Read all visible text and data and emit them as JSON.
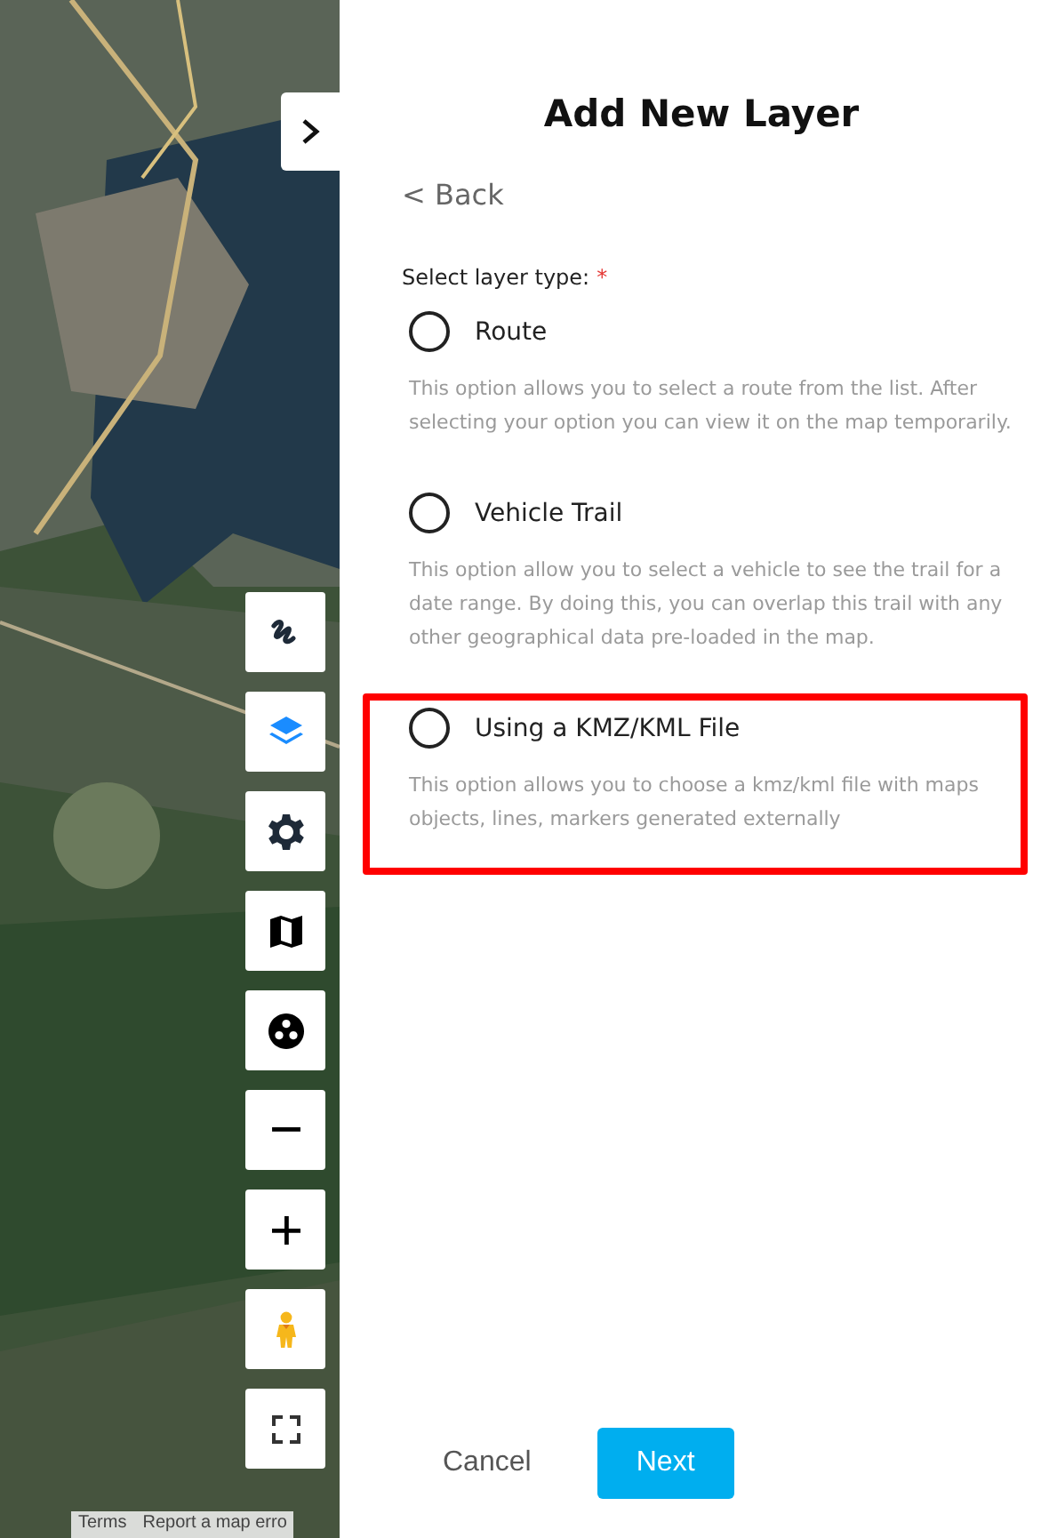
{
  "map": {
    "attribution": [
      "Terms",
      "Report a map erro"
    ],
    "controls": [
      {
        "kind": "trail"
      },
      {
        "kind": "layers"
      },
      {
        "kind": "settings"
      },
      {
        "kind": "map"
      },
      {
        "kind": "cluster"
      },
      {
        "kind": "zoom-out"
      },
      {
        "kind": "zoom-in"
      },
      {
        "kind": "pegman"
      },
      {
        "kind": "fullscreen"
      }
    ]
  },
  "panel": {
    "title": "Add New Layer",
    "back": "< Back",
    "field_label": "Select layer type:",
    "required_mark": "*",
    "options": [
      {
        "label": "Route",
        "description": "This option allows you to select a route from the list. After selecting your option you can view it on the map temporarily.",
        "selected": false,
        "highlighted": false
      },
      {
        "label": "Vehicle Trail",
        "description": "This option allow you to select a vehicle to see the trail for a date range. By doing this, you can overlap this trail with any other geographical data pre-loaded in the map.",
        "selected": false,
        "highlighted": false
      },
      {
        "label": "Using a KMZ/KML File",
        "description": "This option allows you to choose a kmz/kml file with maps objects, lines, markers generated externally",
        "selected": false,
        "highlighted": true
      }
    ],
    "buttons": [
      {
        "kind": "secondary",
        "label": "Cancel"
      },
      {
        "kind": "primary",
        "label": "Next"
      }
    ]
  }
}
